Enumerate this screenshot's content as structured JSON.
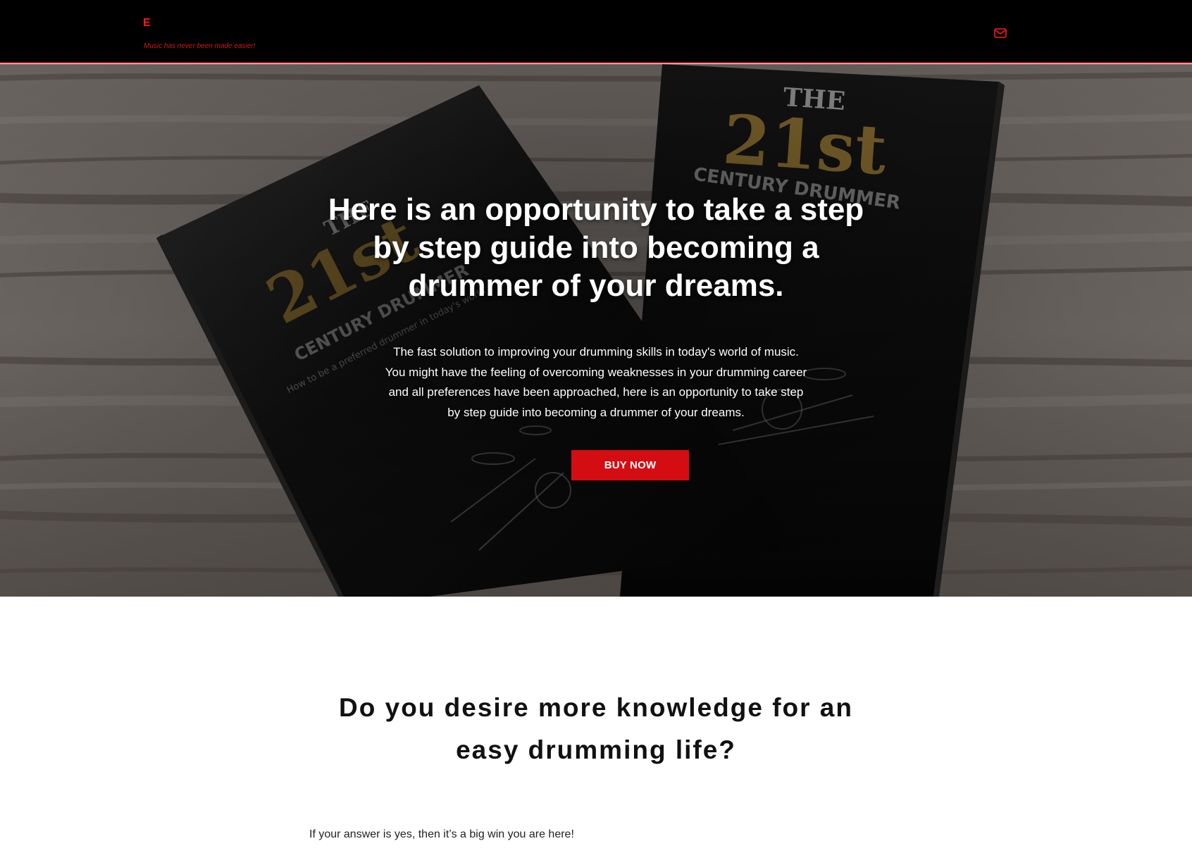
{
  "colors": {
    "header_bg": "#000000",
    "accent_red": "#d40d12",
    "hero_text": "#ffffff",
    "body_text": "#111111"
  },
  "header": {
    "logo_text": "E",
    "tagline": "Music has never been made easier!",
    "mail_icon": "envelope-icon"
  },
  "hero": {
    "background_image": "book-covers-on-wooden-table",
    "book_cover": {
      "the": "THE",
      "number": "21st",
      "subtitle": "CENTURY DRUMMER",
      "strapline": "How to be a preferred drummer in today's music world."
    },
    "headline": "Here is an opportunity to take a step by step guide into becoming a drummer of your dreams.",
    "paragraph": "The fast solution to improving your drumming skills in today's world of music. You might have the feeling of overcoming weaknesses in your drumming career and all preferences have been approached, here is an opportunity to take step by step guide into becoming a drummer of your dreams.",
    "cta_label": "BUY NOW"
  },
  "intro": {
    "heading": "Do you desire more knowledge for an easy drumming life?",
    "text": "If your answer is yes, then it’s a big win you are here!"
  }
}
